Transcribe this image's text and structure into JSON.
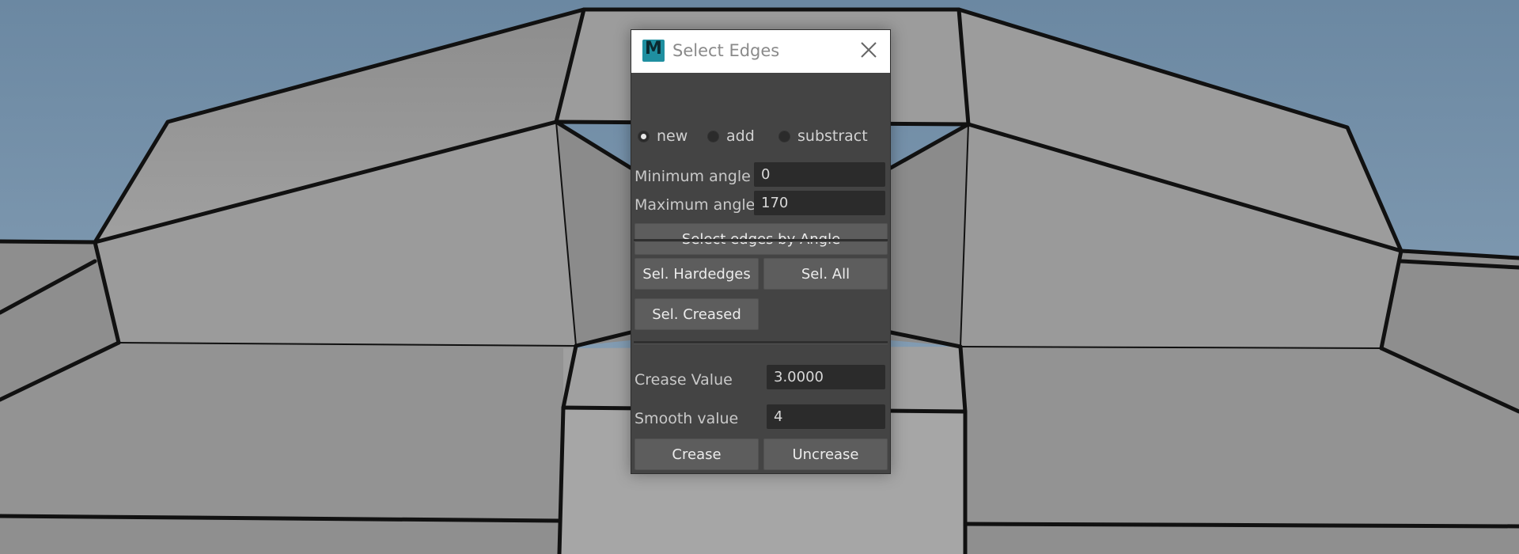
{
  "dialog": {
    "title": "Select Edges",
    "app_icon": "maya-icon",
    "app_letter": "M",
    "close_icon": "close-icon"
  },
  "mode": {
    "options": [
      "new",
      "add",
      "substract"
    ],
    "selected": "new"
  },
  "angle": {
    "min_label": "Minimum angle",
    "min_value": "0",
    "max_label": "Maximum angle",
    "max_value": "170",
    "select_button": "Select edges by Angle"
  },
  "selection": {
    "hardedges_button": "Sel. Hardedges",
    "all_button": "Sel. All",
    "creased_button": "Sel. Creased"
  },
  "crease": {
    "crease_label": "Crease Value",
    "crease_value": "3.0000",
    "smooth_label": "Smooth value",
    "smooth_value": "4",
    "crease_button": "Crease",
    "uncrease_button": "Uncrease"
  },
  "colors": {
    "sky_top": "#6e8aa3",
    "sky_bottom": "#8ea5bb",
    "mesh_face": "#9a9a9a",
    "mesh_edge": "#111111",
    "panel_bg": "#444444",
    "field_bg": "#2b2b2b",
    "button_bg": "#5d5d5d",
    "logo_color": "#1f8fa0"
  }
}
